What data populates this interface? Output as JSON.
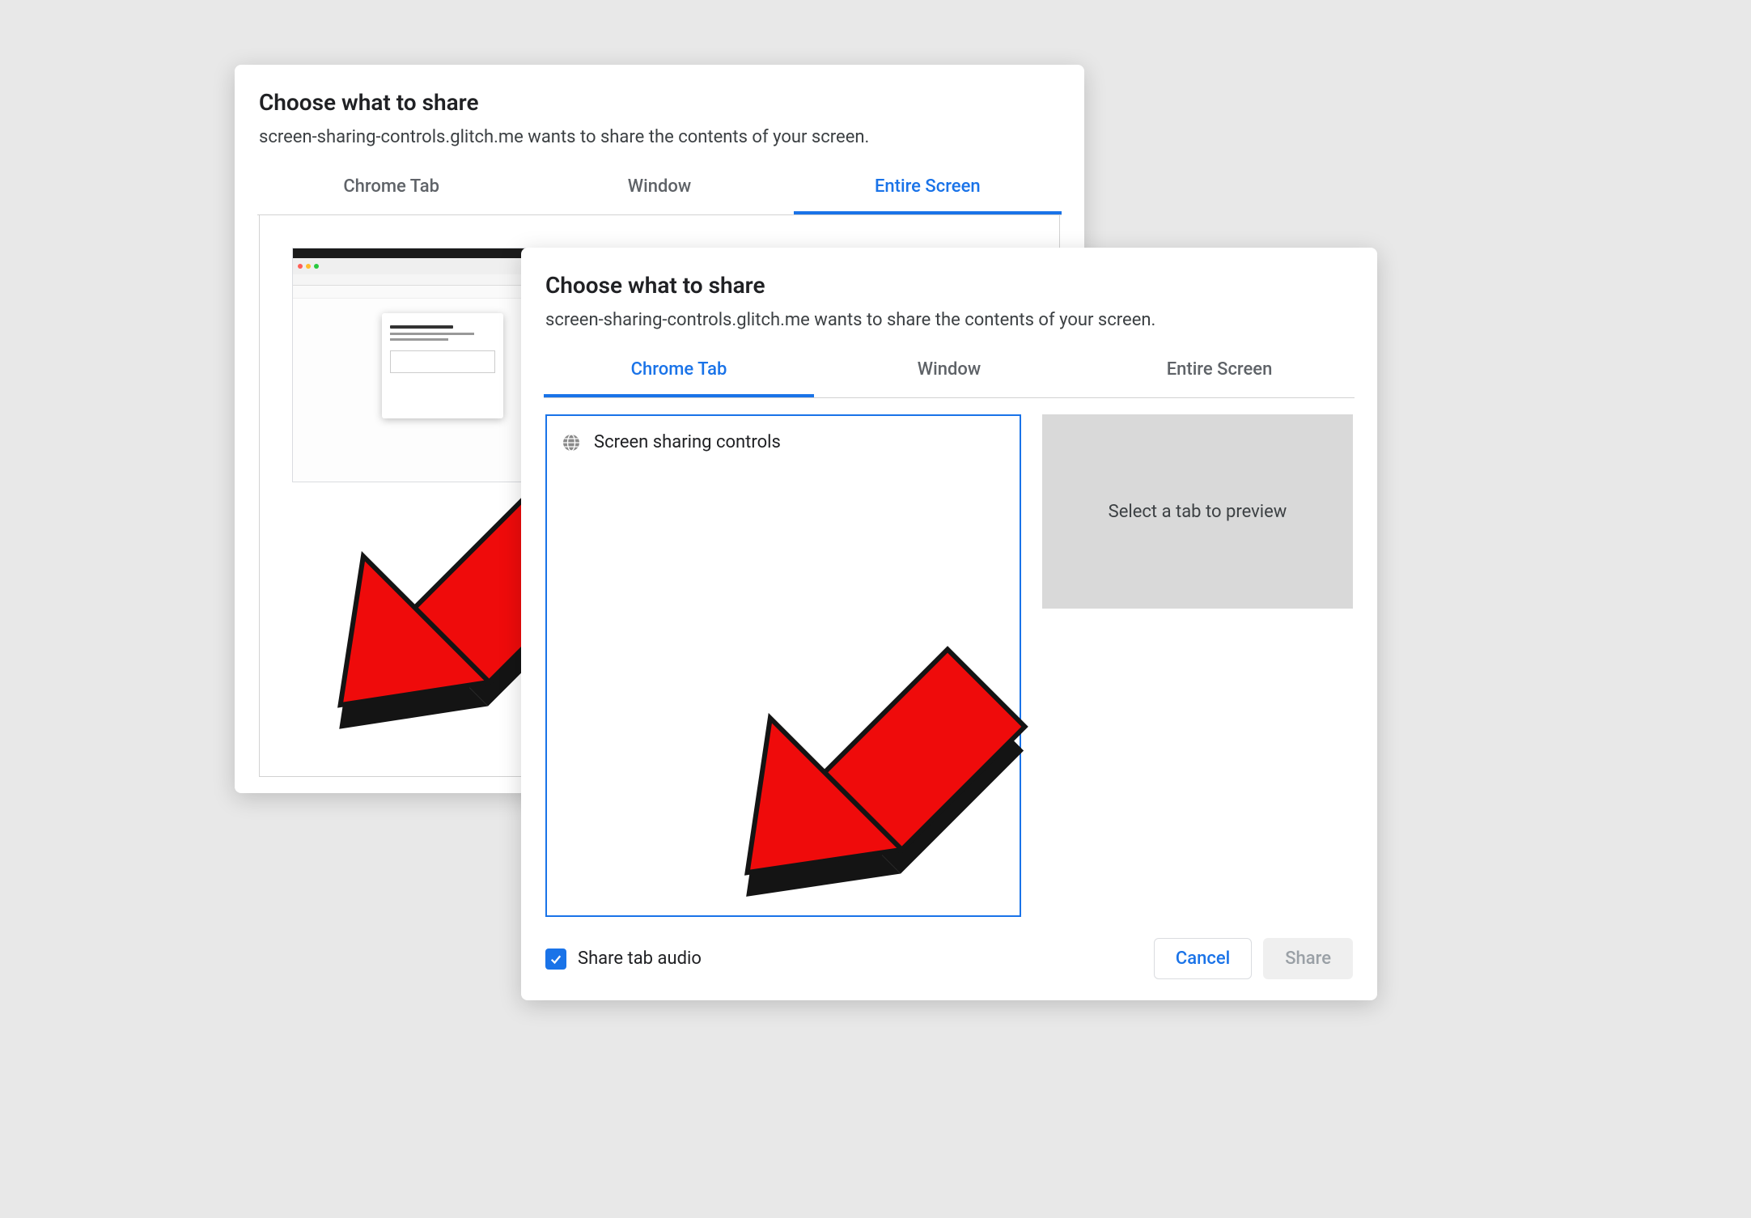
{
  "back": {
    "title": "Choose what to share",
    "desc": "screen-sharing-controls.glitch.me wants to share the contents of your screen.",
    "tabs": {
      "chrome": "Chrome Tab",
      "window": "Window",
      "entire": "Entire Screen"
    },
    "active_tab": "entire"
  },
  "front": {
    "title": "Choose what to share",
    "desc": "screen-sharing-controls.glitch.me wants to share the contents of your screen.",
    "tabs": {
      "chrome": "Chrome Tab",
      "window": "Window",
      "entire": "Entire Screen"
    },
    "active_tab": "chrome",
    "tab_items": [
      {
        "label": "Screen sharing controls"
      }
    ],
    "preview_placeholder": "Select a tab to preview",
    "share_audio_label": "Share tab audio",
    "share_audio_checked": true,
    "buttons": {
      "cancel": "Cancel",
      "share": "Share"
    }
  },
  "colors": {
    "accent": "#1a73e8",
    "arrow_fill": "#ef0b0b",
    "arrow_shadow": "#141414"
  }
}
